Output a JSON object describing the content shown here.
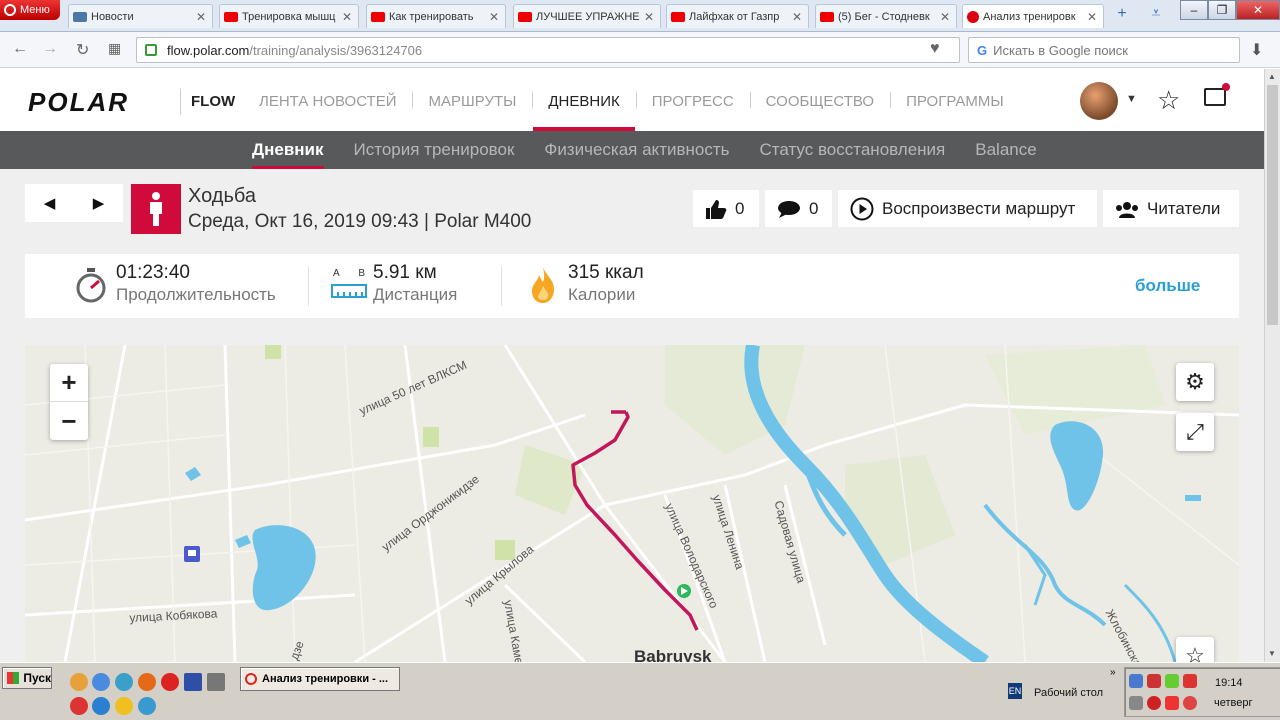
{
  "browser": {
    "menu_label": "Меню",
    "tabs": [
      {
        "title": "Новости",
        "favicon": "vk"
      },
      {
        "title": "Тренировка мышц",
        "favicon": "youtube"
      },
      {
        "title": "Как тренировать",
        "favicon": "youtube"
      },
      {
        "title": "ЛУЧШЕЕ УПРАЖНЕ",
        "favicon": "youtube"
      },
      {
        "title": "Лайфхак от Газпр",
        "favicon": "youtube"
      },
      {
        "title": "(5) Бег - Стодневк",
        "favicon": "youtube"
      },
      {
        "title": "Анализ тренировк",
        "favicon": "polar",
        "active": true
      }
    ],
    "new_tab_symbol": "+",
    "url_domain": "flow.polar.com",
    "url_path": "/training/analysis/3963124706",
    "search_placeholder": "Искать в Google поиск",
    "search_engine_letter": "G"
  },
  "site": {
    "logo": "POLAR",
    "product": "FLOW",
    "main_nav": [
      {
        "label": "ЛЕНТА НОВОСТЕЙ"
      },
      {
        "label": "МАРШРУТЫ"
      },
      {
        "label": "ДНЕВНИК",
        "active": true
      },
      {
        "label": "ПРОГРЕСС"
      },
      {
        "label": "СООБЩЕСТВО"
      },
      {
        "label": "ПРОГРАММЫ"
      }
    ],
    "sub_nav": [
      {
        "label": "Дневник",
        "active": true
      },
      {
        "label": "История тренировок"
      },
      {
        "label": "Физическая активность"
      },
      {
        "label": "Статус восстановления"
      },
      {
        "label": "Balance"
      }
    ]
  },
  "training": {
    "sport": "Ходьба",
    "date_device": "Среда, Окт 16, 2019 09:43 | Polar M400",
    "likes": "0",
    "comments": "0",
    "replay_label": "Воспроизвести маршрут",
    "readers_label": "Читатели",
    "duration": {
      "value": "01:23:40",
      "label": "Продолжительность"
    },
    "distance": {
      "value": "5.91 км",
      "label": "Дистанция",
      "a": "A",
      "b": "B"
    },
    "calories": {
      "value": "315 ккал",
      "label": "Калории"
    },
    "more_label": "больше"
  },
  "map": {
    "zoom_in": "+",
    "zoom_out": "−",
    "streets": [
      "улица 50 лет ВЛКСМ",
      "улица Орджоникидзе",
      "улица Крылова",
      "улица Кобякова",
      "улица Володарского",
      "улица Ленина",
      "Садовая улица",
      "улица Каме",
      "дзе",
      "Жлобинская"
    ],
    "city": "Babruysk",
    "colors": {
      "route": "#c2185b",
      "water": "#6fc2e8",
      "park": "#cfe3a8"
    }
  },
  "taskbar": {
    "start_label": "Пуск",
    "task_label": "Анализ тренировки - ...",
    "lang": "EN",
    "desktop_label": "Рабочий стол",
    "time": "19:14",
    "day": "четверг"
  }
}
